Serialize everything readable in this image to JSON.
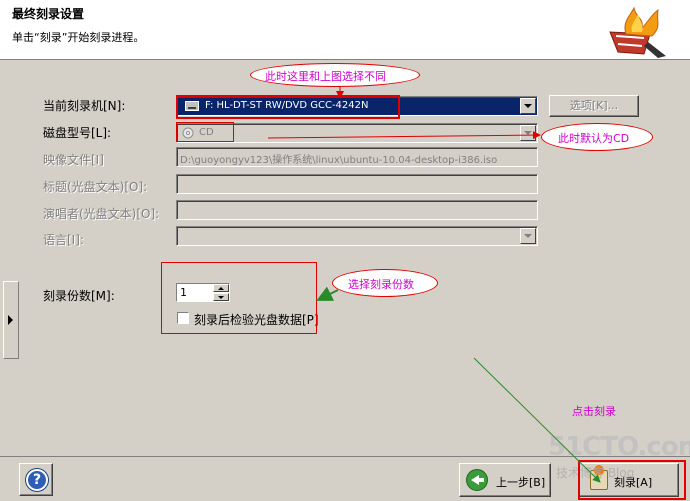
{
  "header": {
    "title": "最终刻录设置",
    "subtitle": "单击“刻录”开始刻录进程。"
  },
  "form": {
    "recorder_label": "当前刻录机[N]:",
    "recorder_value": "F: HL-DT-ST RW/DVD GCC-4242N",
    "options_button": "选项[K]...",
    "disc_type_label": "磁盘型号[L]:",
    "disc_type_value": "CD",
    "image_label": "映像文件[I]",
    "image_value": "D:\\guoyongyv123\\操作系统\\linux\\ubuntu-10.04-desktop-i386.iso",
    "title_label": "标题(光盘文本)[O]:",
    "artist_label": "演唱者(光盘文本)[O]:",
    "language_label": "语言[I]:",
    "copies_label": "刻录份数[M]:",
    "copies_value": "1",
    "verify_label": "刻录后检验光盘数据[P]"
  },
  "footer": {
    "help_symbol": "?",
    "back_label": "上一步[B]",
    "burn_label": "刻录[A]"
  },
  "annotations": {
    "note_recorder": "此时这里和上图选择不同",
    "note_cd": "此时默认为CD",
    "note_copies": "选择刻录份数",
    "note_burn": "点击刻录",
    "color": "#e00000",
    "text_color": "#d000d0"
  },
  "watermark": {
    "main": "51CTO.com",
    "sub": "技术博客  Blog"
  },
  "colors": {
    "window_bg": "#d4d0c8",
    "selection_bg": "#0a246a"
  }
}
